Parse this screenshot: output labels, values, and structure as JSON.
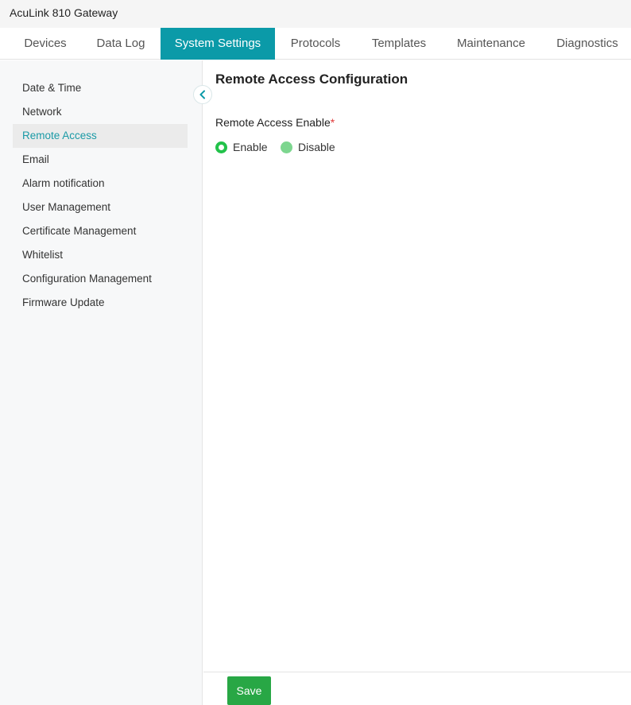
{
  "app": {
    "title": "AcuLink 810 Gateway"
  },
  "tabs": [
    {
      "label": "Devices",
      "active": false
    },
    {
      "label": "Data Log",
      "active": false
    },
    {
      "label": "System Settings",
      "active": true
    },
    {
      "label": "Protocols",
      "active": false
    },
    {
      "label": "Templates",
      "active": false
    },
    {
      "label": "Maintenance",
      "active": false
    },
    {
      "label": "Diagnostics",
      "active": false
    }
  ],
  "sidebar": {
    "items": [
      {
        "label": "Date & Time",
        "active": false
      },
      {
        "label": "Network",
        "active": false
      },
      {
        "label": "Remote Access",
        "active": true
      },
      {
        "label": "Email",
        "active": false
      },
      {
        "label": "Alarm notification",
        "active": false
      },
      {
        "label": "User Management",
        "active": false
      },
      {
        "label": "Certificate Management",
        "active": false
      },
      {
        "label": "Whitelist",
        "active": false
      },
      {
        "label": "Configuration Management",
        "active": false
      },
      {
        "label": "Firmware Update",
        "active": false
      }
    ],
    "collapse_icon": "chevron-left-icon"
  },
  "main": {
    "title": "Remote Access Configuration",
    "field_label": "Remote Access Enable",
    "required_mark": "*",
    "options": [
      {
        "label": "Enable",
        "selected": true
      },
      {
        "label": "Disable",
        "selected": false
      }
    ]
  },
  "footer": {
    "save_label": "Save"
  },
  "colors": {
    "accent": "#0b9aa8",
    "active_sidebar_text": "#1a9aa6",
    "save_button": "#28a745",
    "radio_selected": "#22c24a",
    "radio_unselected": "#7dd68f",
    "required": "#e03a3a"
  }
}
